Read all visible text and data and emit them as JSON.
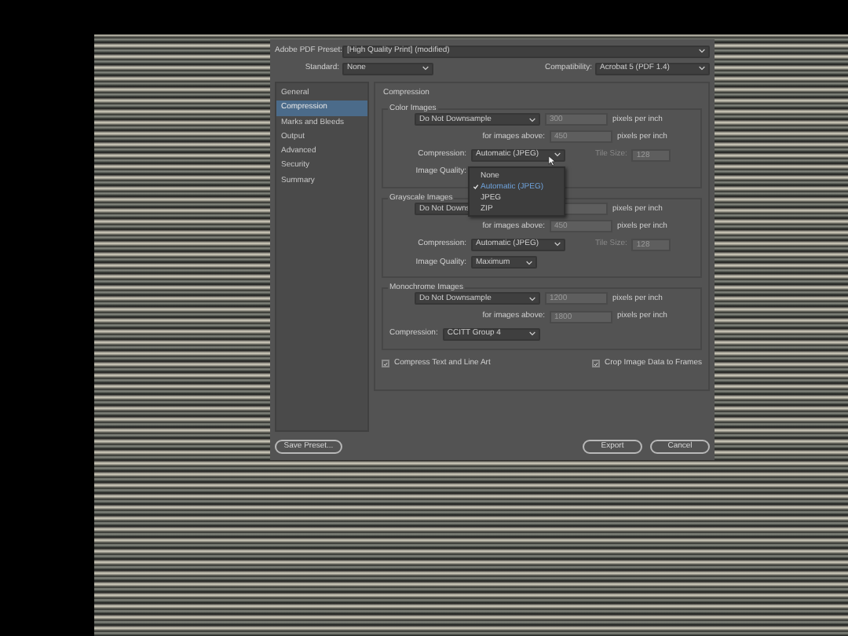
{
  "dialog": {
    "preset_label": "Adobe PDF Preset:",
    "preset": "[High Quality Print] (modified)",
    "standard_label": "Standard:",
    "standard": "None",
    "compatibility_label": "Compatibility:",
    "compatibility": "Acrobat 5 (PDF 1.4)"
  },
  "sidebar": {
    "items": [
      {
        "label": "General",
        "selected": false
      },
      {
        "label": "Compression",
        "selected": true
      },
      {
        "label": "Marks and Bleeds",
        "selected": false
      },
      {
        "label": "Output",
        "selected": false
      },
      {
        "label": "Advanced",
        "selected": false
      },
      {
        "label": "Security",
        "selected": false
      },
      {
        "label": "Summary",
        "selected": false
      }
    ]
  },
  "section_title": "Compression",
  "groups": [
    {
      "title": "Color Images",
      "rows": [
        {
          "kind": "downsample",
          "select": "Do Not Downsample",
          "value": "300",
          "unit": "pixels per inch"
        },
        {
          "kind": "above",
          "label": "for images above:",
          "value": "450",
          "unit": "pixels per inch"
        },
        {
          "kind": "compression",
          "label": "Compression:",
          "select": "Automatic (JPEG)",
          "tile_label": "Tile Size:",
          "tile_value": "128"
        },
        {
          "kind": "quality",
          "label": "Image Quality:"
        }
      ]
    },
    {
      "title": "Grayscale Images",
      "rows": [
        {
          "kind": "downsample",
          "select": "Do Not Downs",
          "unit": "pixels per inch"
        },
        {
          "kind": "above",
          "label": "for images above:",
          "value": "450",
          "unit": "pixels per inch"
        },
        {
          "kind": "compression",
          "label": "Compression:",
          "select": "Automatic (JPEG)",
          "tile_label": "Tile Size:",
          "tile_value": "128"
        },
        {
          "kind": "quality",
          "label": "Image Quality:",
          "select": "Maximum"
        }
      ]
    },
    {
      "title": "Monochrome Images",
      "rows": [
        {
          "kind": "downsample",
          "select": "Do Not Downsample",
          "value": "1200",
          "unit": "pixels per inch"
        },
        {
          "kind": "above",
          "label": "for images above:",
          "value": "1800",
          "unit": "pixels per inch"
        },
        {
          "kind": "compression",
          "label": "Compression:",
          "select": "CCITT Group 4"
        }
      ]
    }
  ],
  "checkboxes": [
    {
      "label": "Compress Text and Line Art",
      "checked": true
    },
    {
      "label": "Crop Image Data to Frames",
      "checked": true
    }
  ],
  "dropdown_menu": {
    "items": [
      {
        "label": "None",
        "selected": false
      },
      {
        "label": "Automatic (JPEG)",
        "selected": true
      },
      {
        "label": "JPEG",
        "selected": false
      },
      {
        "label": "ZIP",
        "selected": false
      }
    ]
  },
  "buttons": [
    {
      "label": "Save Preset...",
      "kind": "secondary"
    },
    {
      "label": "Export",
      "kind": "primary"
    },
    {
      "label": "Cancel",
      "kind": "primary"
    }
  ]
}
